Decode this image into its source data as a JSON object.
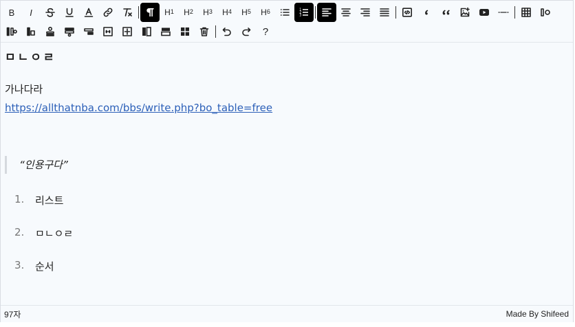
{
  "toolbar": {
    "row1": [
      {
        "name": "bold-button",
        "icon": "bold-icon",
        "label": "B"
      },
      {
        "name": "italic-button",
        "icon": "italic-icon",
        "label": "I"
      },
      {
        "name": "strikethrough-button",
        "icon": "strikethrough-icon"
      },
      {
        "name": "underline-button",
        "icon": "underline-icon"
      },
      {
        "name": "font-color-button",
        "icon": "font-color-icon"
      },
      {
        "name": "link-button",
        "icon": "link-icon"
      },
      {
        "name": "clear-format-button",
        "icon": "clear-format-icon"
      },
      {
        "sep": true
      },
      {
        "name": "paragraph-button",
        "icon": "pilcrow-icon",
        "active": true
      },
      {
        "name": "heading1-button",
        "icon": "heading1-icon",
        "label": "H",
        "sub": "1"
      },
      {
        "name": "heading2-button",
        "icon": "heading2-icon",
        "label": "H",
        "sub": "2"
      },
      {
        "name": "heading3-button",
        "icon": "heading3-icon",
        "label": "H",
        "sub": "3"
      },
      {
        "name": "heading4-button",
        "icon": "heading4-icon",
        "label": "H",
        "sub": "4"
      },
      {
        "name": "heading5-button",
        "icon": "heading5-icon",
        "label": "H",
        "sub": "5"
      },
      {
        "name": "heading6-button",
        "icon": "heading6-icon",
        "label": "H",
        "sub": "6"
      },
      {
        "name": "bullet-list-button",
        "icon": "bullet-list-icon"
      },
      {
        "name": "ordered-list-button",
        "icon": "ordered-list-icon",
        "active": true
      },
      {
        "sep": true
      },
      {
        "name": "align-left-button",
        "icon": "align-left-icon",
        "active": true
      },
      {
        "name": "align-center-button",
        "icon": "align-center-icon"
      },
      {
        "name": "align-right-button",
        "icon": "align-right-icon"
      },
      {
        "name": "align-justify-button",
        "icon": "align-justify-icon"
      },
      {
        "sep": true
      },
      {
        "name": "code-block-button",
        "icon": "code-icon"
      },
      {
        "name": "quote-single-button",
        "icon": "quote-single-icon"
      },
      {
        "name": "quote-double-button",
        "icon": "quote-double-icon"
      },
      {
        "name": "insert-image-button",
        "icon": "image-add-icon"
      },
      {
        "name": "insert-video-button",
        "icon": "youtube-icon"
      },
      {
        "name": "horizontal-rule-button",
        "icon": "horizontal-rule-icon"
      },
      {
        "sep": true
      },
      {
        "name": "insert-table-button",
        "icon": "table-icon"
      },
      {
        "name": "insert-column-after-button",
        "icon": "column-insert-right-icon"
      }
    ],
    "row2": [
      {
        "name": "insert-column-before-button",
        "icon": "column-insert-left-icon"
      },
      {
        "name": "delete-column-button",
        "icon": "column-delete-icon"
      },
      {
        "name": "insert-row-before-button",
        "icon": "row-insert-top-icon"
      },
      {
        "name": "insert-row-after-button",
        "icon": "row-insert-bottom-icon"
      },
      {
        "name": "delete-row-button",
        "icon": "row-delete-icon"
      },
      {
        "name": "merge-cells-button",
        "icon": "merge-cells-icon"
      },
      {
        "name": "split-cell-button",
        "icon": "split-cell-icon"
      },
      {
        "name": "toggle-header-column-button",
        "icon": "header-column-icon"
      },
      {
        "name": "toggle-header-row-button",
        "icon": "header-row-icon"
      },
      {
        "name": "toggle-header-cell-button",
        "icon": "header-cell-icon"
      },
      {
        "name": "delete-table-button",
        "icon": "trash-icon"
      },
      {
        "sep": true
      },
      {
        "name": "undo-button",
        "icon": "undo-icon"
      },
      {
        "name": "redo-button",
        "icon": "redo-icon"
      },
      {
        "name": "help-button",
        "icon": "question-icon",
        "label": "?"
      }
    ]
  },
  "content": {
    "heading": "ㅁㄴㅇㄹ",
    "paragraph": "가나다라",
    "link": "https://allthatnba.com/bbs/write.php?bo_table=free",
    "quote": "“인용구다”",
    "list": [
      {
        "num": "1.",
        "text": "리스트"
      },
      {
        "num": "2.",
        "text": "ㅁㄴㅇㄹ"
      },
      {
        "num": "3.",
        "text": "순서"
      }
    ]
  },
  "status": {
    "char_count": "97자",
    "credit": "Made By Shifeed"
  },
  "colors": {
    "background": "#f7fafd",
    "active_button": "#000000",
    "link": "#2b5fb8"
  }
}
